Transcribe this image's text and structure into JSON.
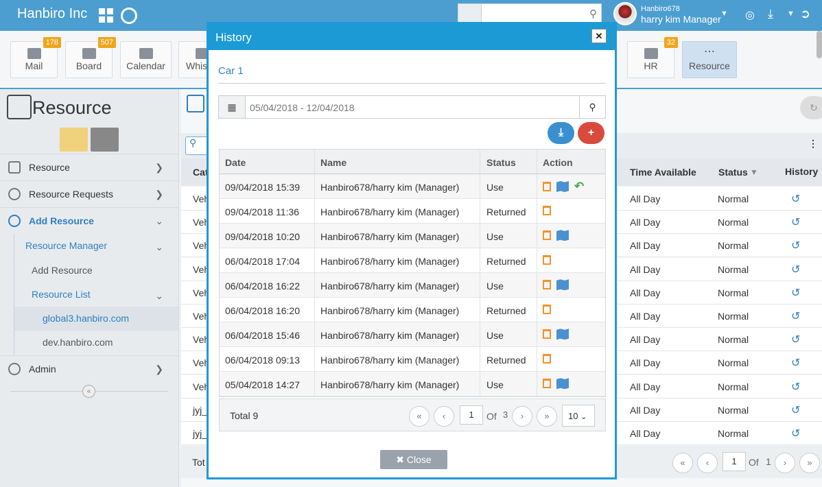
{
  "header": {
    "brand": "Hanbiro Inc",
    "user_id": "Hanbiro678",
    "user_name": "harry kim Manager"
  },
  "apps": [
    {
      "label": "Mail",
      "badge": "178"
    },
    {
      "label": "Board",
      "badge": "507"
    },
    {
      "label": "Calendar",
      "badge": ""
    },
    {
      "label": "Whis",
      "badge": ""
    },
    {
      "label": "HR",
      "badge": "32"
    },
    {
      "label": "Resource",
      "badge": ""
    }
  ],
  "sidebar": {
    "title": "Resource",
    "menu": [
      {
        "label": "Resource"
      },
      {
        "label": "Resource Requests"
      },
      {
        "label": "Add Resource"
      }
    ],
    "sub": {
      "resource_manager": "Resource Manager",
      "add_resource": "Add Resource",
      "resource_list": "Resource List",
      "domain1": "global3.hanbiro.com",
      "domain2": "dev.hanbiro.com"
    },
    "admin": "Admin"
  },
  "bg_table": {
    "headers": {
      "cat": "Cat",
      "time": "Time Available",
      "status": "Status",
      "history": "History"
    },
    "rows": [
      {
        "cat": "Veh",
        "time": "All Day",
        "status": "Normal"
      },
      {
        "cat": "Veh",
        "time": "All Day",
        "status": "Normal"
      },
      {
        "cat": "Veh",
        "time": "All Day",
        "status": "Normal"
      },
      {
        "cat": "Veh",
        "time": "All Day",
        "status": "Normal"
      },
      {
        "cat": "Veh",
        "time": "All Day",
        "status": "Normal"
      },
      {
        "cat": "Veh",
        "time": "All Day",
        "status": "Normal"
      },
      {
        "cat": "Veh",
        "time": "All Day",
        "status": "Normal"
      },
      {
        "cat": "Veh",
        "time": "All Day",
        "status": "Normal"
      },
      {
        "cat": "Veh",
        "time": "All Day",
        "status": "Normal"
      },
      {
        "cat": "jyj_",
        "time": "All Day",
        "status": "Normal"
      },
      {
        "cat": "jyj_",
        "time": "All Day",
        "status": "Normal"
      }
    ],
    "footer": {
      "total": "Tot",
      "page": "1",
      "of": "Of",
      "pages": "1"
    }
  },
  "modal": {
    "title": "History",
    "car": "Car 1",
    "date_range": "05/04/2018 - 12/04/2018",
    "headers": {
      "date": "Date",
      "name": "Name",
      "status": "Status",
      "action": "Action"
    },
    "rows": [
      {
        "date": "09/04/2018 15:39",
        "name": "Hanbiro678/harry kim (Manager)",
        "status": "Use",
        "map": true,
        "undo": true
      },
      {
        "date": "09/04/2018 11:36",
        "name": "Hanbiro678/harry kim (Manager)",
        "status": "Returned",
        "map": false,
        "undo": false
      },
      {
        "date": "09/04/2018 10:20",
        "name": "Hanbiro678/harry kim (Manager)",
        "status": "Use",
        "map": true,
        "undo": false
      },
      {
        "date": "06/04/2018 17:04",
        "name": "Hanbiro678/harry kim (Manager)",
        "status": "Returned",
        "map": false,
        "undo": false
      },
      {
        "date": "06/04/2018 16:22",
        "name": "Hanbiro678/harry kim (Manager)",
        "status": "Use",
        "map": true,
        "undo": false
      },
      {
        "date": "06/04/2018 16:20",
        "name": "Hanbiro678/harry kim (Manager)",
        "status": "Returned",
        "map": false,
        "undo": false
      },
      {
        "date": "06/04/2018 15:46",
        "name": "Hanbiro678/harry kim (Manager)",
        "status": "Use",
        "map": true,
        "undo": false
      },
      {
        "date": "06/04/2018 09:13",
        "name": "Hanbiro678/harry kim (Manager)",
        "status": "Returned",
        "map": false,
        "undo": false
      },
      {
        "date": "05/04/2018 14:27",
        "name": "Hanbiro678/harry kim (Manager)",
        "status": "Use",
        "map": true,
        "undo": false
      }
    ],
    "footer": {
      "total": "Total 9",
      "page": "1",
      "of": "Of",
      "pages": "3",
      "page_size": "10"
    },
    "close": "Close"
  }
}
